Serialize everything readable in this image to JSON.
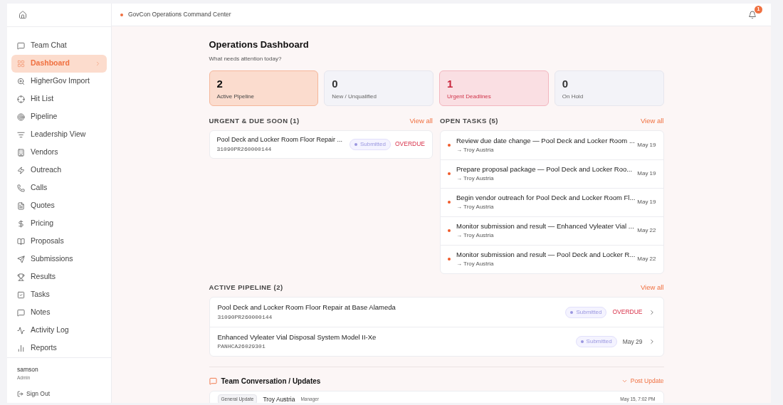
{
  "header": {
    "title": "GovCon Operations Command Center",
    "notifications": "1"
  },
  "sidebar": {
    "items": [
      {
        "label": "Team Chat",
        "selected": false
      },
      {
        "label": "Dashboard",
        "selected": true
      },
      {
        "label": "HigherGov Import",
        "selected": false
      },
      {
        "label": "Hit List",
        "selected": false
      },
      {
        "label": "Pipeline",
        "selected": false
      },
      {
        "label": "Leadership View",
        "selected": false
      },
      {
        "label": "Vendors",
        "selected": false
      },
      {
        "label": "Outreach",
        "selected": false
      },
      {
        "label": "Calls",
        "selected": false
      },
      {
        "label": "Quotes",
        "selected": false
      },
      {
        "label": "Pricing",
        "selected": false
      },
      {
        "label": "Proposals",
        "selected": false
      },
      {
        "label": "Submissions",
        "selected": false
      },
      {
        "label": "Results",
        "selected": false
      },
      {
        "label": "Tasks",
        "selected": false
      },
      {
        "label": "Notes",
        "selected": false
      },
      {
        "label": "Activity Log",
        "selected": false
      },
      {
        "label": "Reports",
        "selected": false
      }
    ],
    "user": {
      "name": "samson",
      "role": "Admin"
    },
    "sign_out": "Sign Out"
  },
  "page": {
    "title": "Operations Dashboard",
    "subtitle": "What needs attention today?"
  },
  "stats": [
    {
      "value": "2",
      "label": "Active Pipeline",
      "kind": "accent"
    },
    {
      "value": "0",
      "label": "New / Unqualified",
      "kind": "neutral"
    },
    {
      "value": "1",
      "label": "Urgent Deadlines",
      "kind": "urgent"
    },
    {
      "value": "0",
      "label": "On Hold",
      "kind": "neutral"
    }
  ],
  "urgent": {
    "title": "URGENT & DUE SOON (1)",
    "view_all": "View all",
    "items": [
      {
        "title": "Pool Deck and Locker Room Floor Repair ...",
        "code": "31090PR260000144",
        "status": "Submitted",
        "due": "OVERDUE",
        "overdue": true
      }
    ]
  },
  "tasks": {
    "title": "OPEN TASKS (5)",
    "view_all": "View all",
    "items": [
      {
        "title": "Review due date change — Pool Deck and Locker Room ...",
        "assignee": "→ Troy Austria",
        "date": "May 19"
      },
      {
        "title": "Prepare proposal package — Pool Deck and Locker Roo...",
        "assignee": "→ Troy Austria",
        "date": "May 19"
      },
      {
        "title": "Begin vendor outreach for Pool Deck and Locker Room Fl...",
        "assignee": "→ Troy Austria",
        "date": "May 19"
      },
      {
        "title": "Monitor submission and result — Enhanced Vyleater Vial ...",
        "assignee": "→ Troy Austria",
        "date": "May 22"
      },
      {
        "title": "Monitor submission and result — Pool Deck and Locker R...",
        "assignee": "→ Troy Austria",
        "date": "May 22"
      }
    ]
  },
  "pipeline": {
    "title": "ACTIVE PIPELINE (2)",
    "view_all": "View all",
    "items": [
      {
        "title": "Pool Deck and Locker Room Floor Repair at Base Alameda",
        "code": "31090PR260000144",
        "status": "Submitted",
        "due": "OVERDUE",
        "overdue": true
      },
      {
        "title": "Enhanced Vyleater Vial Disposal System Model II-Xe",
        "code": "PANHCA26029301",
        "status": "Submitted",
        "due": "May 29",
        "overdue": false
      }
    ]
  },
  "conversation": {
    "title": "Team Conversation / Updates",
    "post": "Post Update",
    "posts": [
      {
        "tag": "General Update",
        "author": "Troy Austria",
        "role": "Manager",
        "time": "May 15, 7:02 PM"
      }
    ]
  }
}
